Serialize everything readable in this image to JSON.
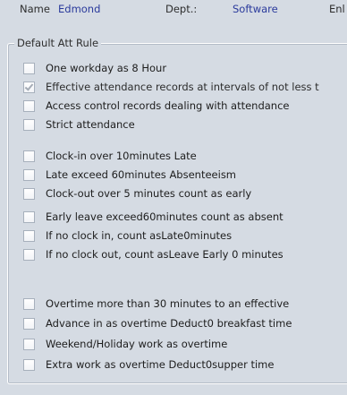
{
  "header": {
    "name_label": "Name",
    "name_value": "Edmond",
    "dept_label": "Dept.:",
    "dept_value": "Software",
    "extra_label": "Enl"
  },
  "group": {
    "title": "Default Att Rule",
    "items": [
      {
        "label": "One workday as 8 Hour",
        "checked": false
      },
      {
        "label": "Effective attendance records at intervals of not less t",
        "checked": true
      },
      {
        "label": "Access control records dealing with attendance",
        "checked": false
      },
      {
        "label": "Strict attendance",
        "checked": false
      },
      {
        "label": "Clock-in over 10minutes Late",
        "checked": false
      },
      {
        "label": "Late exceed 60minutes Absenteeism",
        "checked": false
      },
      {
        "label": "Clock-out over 5 minutes count as early",
        "checked": false
      },
      {
        "label": "Early leave exceed60minutes count as absent",
        "checked": false
      },
      {
        "label": "If no clock in, count asLate0minutes",
        "checked": false
      },
      {
        "label": "If no clock out, count asLeave Early 0 minutes",
        "checked": false
      },
      {
        "label": "Overtime more than 30 minutes to an effective",
        "checked": false
      },
      {
        "label": "Advance in as overtime Deduct0 breakfast time",
        "checked": false
      },
      {
        "label": "Weekend/Holiday work as overtime",
        "checked": false
      },
      {
        "label": "Extra work as overtime Deduct0supper time",
        "checked": false
      }
    ]
  }
}
